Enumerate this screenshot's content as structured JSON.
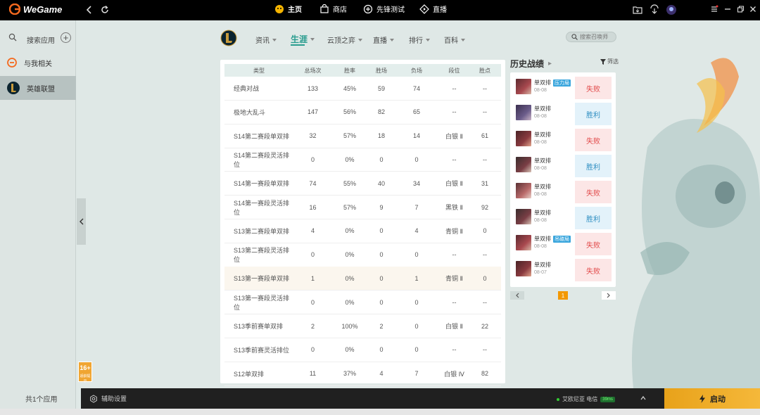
{
  "app": {
    "name": "WeGame"
  },
  "topnav": {
    "items": [
      {
        "label": "主页",
        "icon": "home-icon",
        "active": true
      },
      {
        "label": "商店",
        "icon": "shop-icon",
        "active": false
      },
      {
        "label": "先锋测试",
        "icon": "gamepad-icon",
        "active": false
      },
      {
        "label": "直播",
        "icon": "live-icon",
        "active": false
      }
    ]
  },
  "sidebar": {
    "search_label": "搜索应用",
    "items": [
      {
        "label": "与我相关",
        "icon": "related-icon"
      },
      {
        "label": "英雄联盟",
        "icon": "lol-logo-icon",
        "selected": true
      }
    ],
    "footer": "共1个应用",
    "age_rating": "16+",
    "age_sub": "适龄提示"
  },
  "subnav": {
    "items": [
      {
        "label": "资讯"
      },
      {
        "label": "生涯",
        "active": true
      },
      {
        "label": "云顶之弈"
      },
      {
        "label": "直播"
      },
      {
        "label": "排行"
      },
      {
        "label": "百科"
      }
    ],
    "search_placeholder": "搜索召唤师"
  },
  "stats": {
    "headers": [
      "类型",
      "总场次",
      "胜率",
      "胜场",
      "负场",
      "段位",
      "胜点"
    ],
    "rows": [
      [
        "经典对战",
        "133",
        "45%",
        "59",
        "74",
        "--",
        "--"
      ],
      [
        "极地大乱斗",
        "147",
        "56%",
        "82",
        "65",
        "--",
        "--"
      ],
      [
        "S14第二赛段单双排",
        "32",
        "57%",
        "18",
        "14",
        "白银 Ⅱ",
        "61"
      ],
      [
        "S14第二赛段灵活排位",
        "0",
        "0%",
        "0",
        "0",
        "--",
        "--"
      ],
      [
        "S14第一赛段单双排",
        "74",
        "55%",
        "40",
        "34",
        "白银 Ⅱ",
        "31"
      ],
      [
        "S14第一赛段灵活排位",
        "16",
        "57%",
        "9",
        "7",
        "黑铁 Ⅱ",
        "92"
      ],
      [
        "S13第二赛段单双排",
        "4",
        "0%",
        "0",
        "4",
        "青铜 Ⅱ",
        "0"
      ],
      [
        "S13第二赛段灵活排位",
        "0",
        "0%",
        "0",
        "0",
        "--",
        "--"
      ],
      [
        "S13第一赛段单双排",
        "1",
        "0%",
        "0",
        "1",
        "青铜 Ⅱ",
        "0"
      ],
      [
        "S13第一赛段灵活排位",
        "0",
        "0%",
        "0",
        "0",
        "--",
        "--"
      ],
      [
        "S13季前赛单双排",
        "2",
        "100%",
        "2",
        "0",
        "白银 Ⅱ",
        "22"
      ],
      [
        "S13季前赛灵活排位",
        "0",
        "0%",
        "0",
        "0",
        "--",
        "--"
      ],
      [
        "S12单双排",
        "11",
        "37%",
        "4",
        "7",
        "白银 Ⅳ",
        "82"
      ]
    ]
  },
  "history": {
    "title": "历史战绩",
    "filter_label": "筛选",
    "matches": [
      {
        "mode": "单双排",
        "tag": "压力局",
        "date": "08-08",
        "result": "失败",
        "win": false
      },
      {
        "mode": "单双排",
        "tag": "",
        "date": "08-08",
        "result": "胜利",
        "win": true
      },
      {
        "mode": "单双排",
        "tag": "",
        "date": "08-08",
        "result": "失败",
        "win": false
      },
      {
        "mode": "单双排",
        "tag": "",
        "date": "08-08",
        "result": "胜利",
        "win": true
      },
      {
        "mode": "单双排",
        "tag": "",
        "date": "08-08",
        "result": "失败",
        "win": false
      },
      {
        "mode": "单双排",
        "tag": "",
        "date": "08-08",
        "result": "胜利",
        "win": true
      },
      {
        "mode": "单双排",
        "tag": "吊碳局",
        "date": "08-08",
        "result": "失败",
        "win": false
      },
      {
        "mode": "单双排",
        "tag": "",
        "date": "08-07",
        "result": "失败",
        "win": false
      }
    ],
    "page": "1"
  },
  "bottombar": {
    "aux_label": "辅助设置",
    "server": "艾欧尼亚 电信",
    "ping": "39ms",
    "launch_label": "启动"
  },
  "colors": {
    "accent": "#2a9d8f",
    "lose": "#e24a4a",
    "win": "#2f8fc2",
    "launch": "#f5b83a"
  }
}
